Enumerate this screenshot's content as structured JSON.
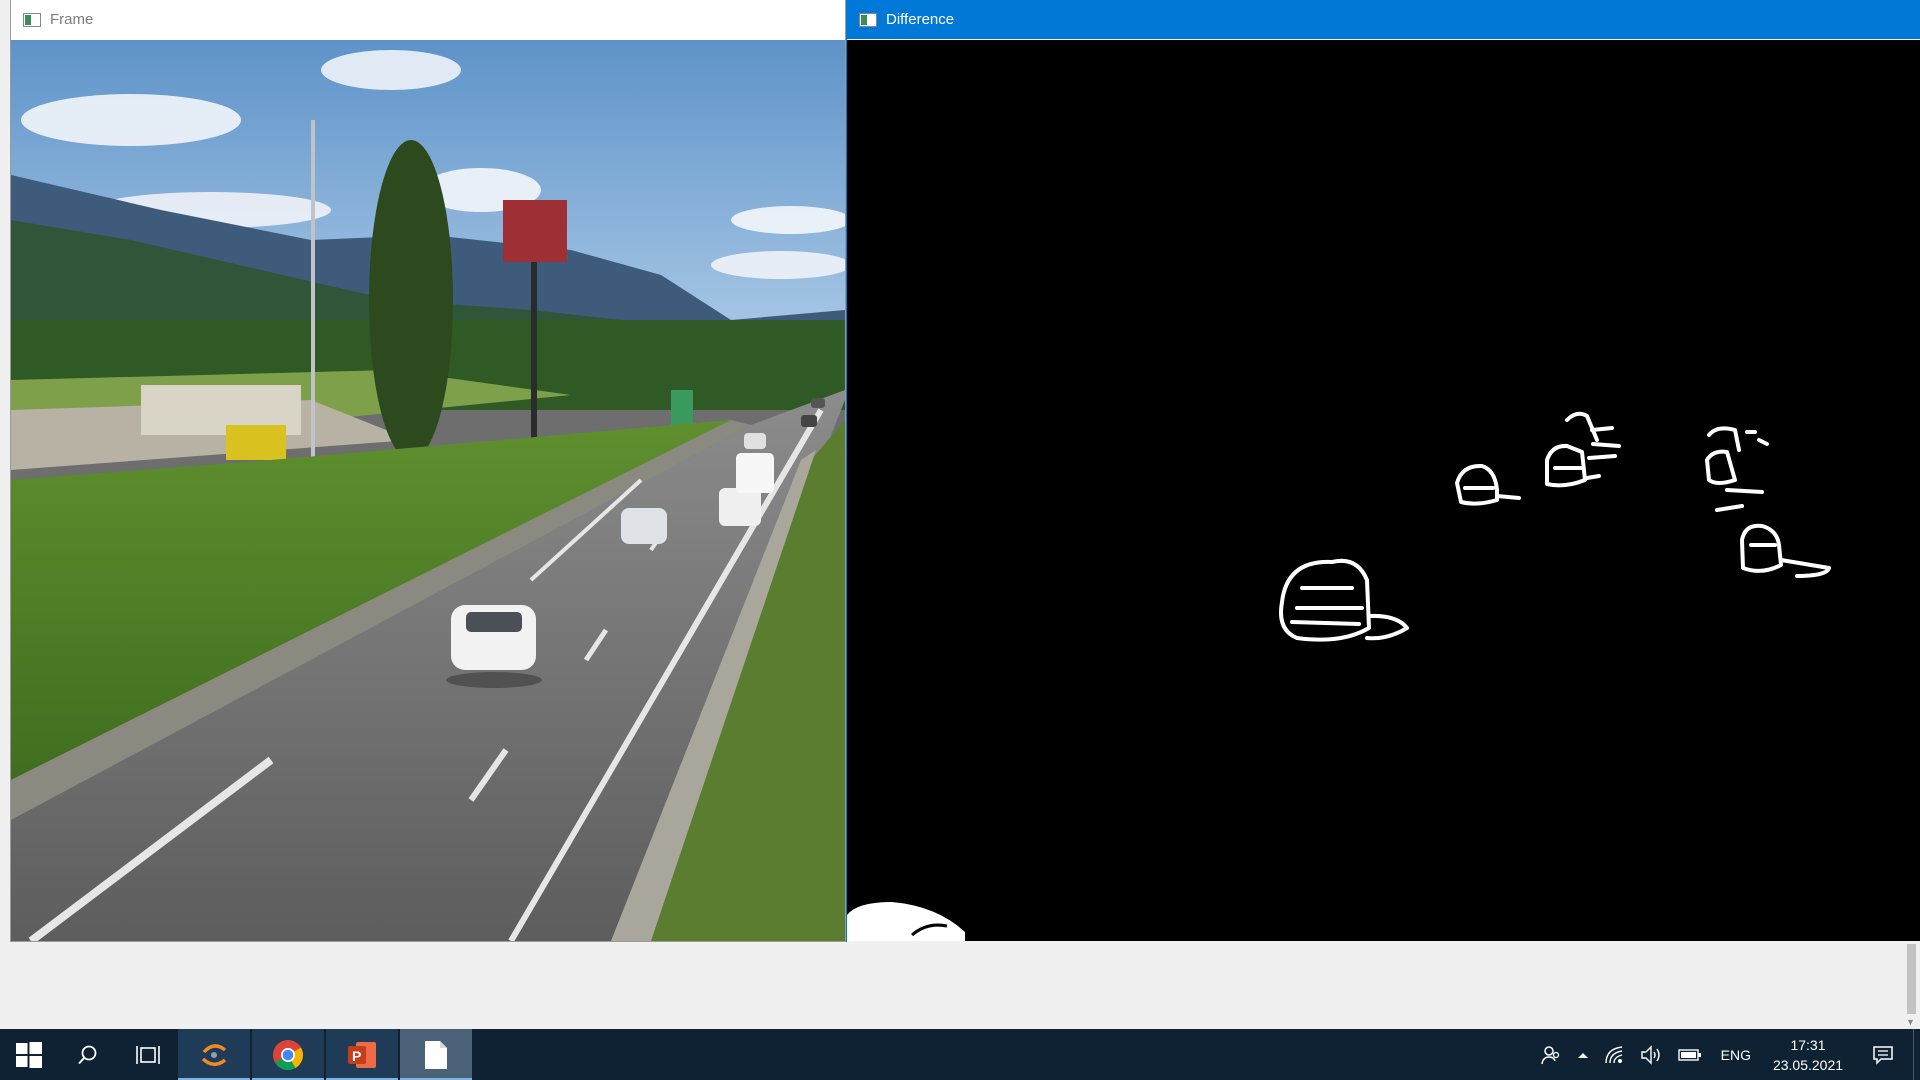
{
  "windows": {
    "frame": {
      "title": "Frame"
    },
    "difference": {
      "title": "Difference"
    }
  },
  "taskbar": {
    "start_icon": "windows-logo-icon",
    "search_icon": "search-icon",
    "task_view_icon": "task-view-icon",
    "pinned_apps": [
      {
        "name": "spyder",
        "icon": "spyder-icon"
      },
      {
        "name": "chrome",
        "icon": "chrome-icon"
      },
      {
        "name": "powerpoint",
        "icon": "powerpoint-icon"
      },
      {
        "name": "document",
        "icon": "blank-document-icon"
      }
    ],
    "tray": {
      "language": "ENG",
      "time": "17:31",
      "date": "23.05.2021"
    }
  },
  "colors": {
    "accent_titlebar": "#0078d7",
    "taskbar": "#0e2234",
    "mask_background": "#000000",
    "mask_foreground": "#ffffff"
  }
}
